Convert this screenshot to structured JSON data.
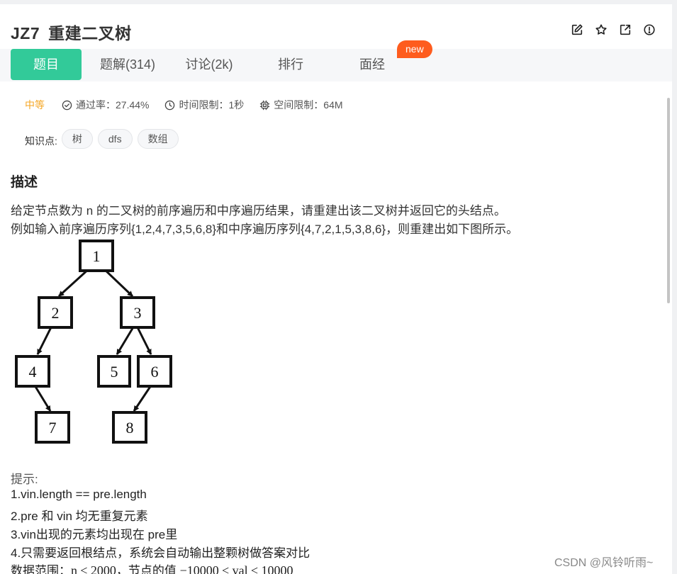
{
  "problem": {
    "id": "JZ7",
    "title": "重建二叉树"
  },
  "toolbar": {
    "icons": [
      "edit-icon",
      "star-icon",
      "share-icon",
      "report-icon"
    ]
  },
  "tabs": [
    {
      "label": "题目",
      "active": true
    },
    {
      "label": "题解(314)",
      "active": false
    },
    {
      "label": "讨论(2k)",
      "active": false
    },
    {
      "label": "排行",
      "active": false
    },
    {
      "label": "面经",
      "active": false
    }
  ],
  "badge": "new",
  "meta": {
    "difficulty": "中等",
    "pass_rate": "通过率：27.44%",
    "time_limit": "时间限制：1秒",
    "space_limit": "空间限制：64M"
  },
  "knowledge": {
    "label": "知识点:",
    "tags": [
      "树",
      "dfs",
      "数组"
    ]
  },
  "description": {
    "title": "描述",
    "line1": "给定节点数为 n 的二叉树的前序遍历和中序遍历结果，请重建出该二叉树并返回它的头结点。",
    "line2": "例如输入前序遍历序列{1,2,4,7,3,5,6,8}和中序遍历序列{4,7,2,1,5,3,8,6}，则重建出如下图所示。"
  },
  "tree": {
    "nodes": [
      "1",
      "2",
      "3",
      "4",
      "5",
      "6",
      "7",
      "8"
    ]
  },
  "hints": {
    "title": "提示:",
    "items": [
      "1.vin.length == pre.length",
      "2.pre 和 vin 均无重复元素",
      "3.vin出现的元素均出现在 pre里",
      "4.只需要返回根结点，系统会自动输出整颗树做答案对比"
    ]
  },
  "range": {
    "label": "数据范围：",
    "expr1": "n ≤ 2000",
    "mid": "，节点的值 ",
    "expr2": "−10000 ≤ val ≤ 10000"
  },
  "watermark": "CSDN @风铃听雨~"
}
